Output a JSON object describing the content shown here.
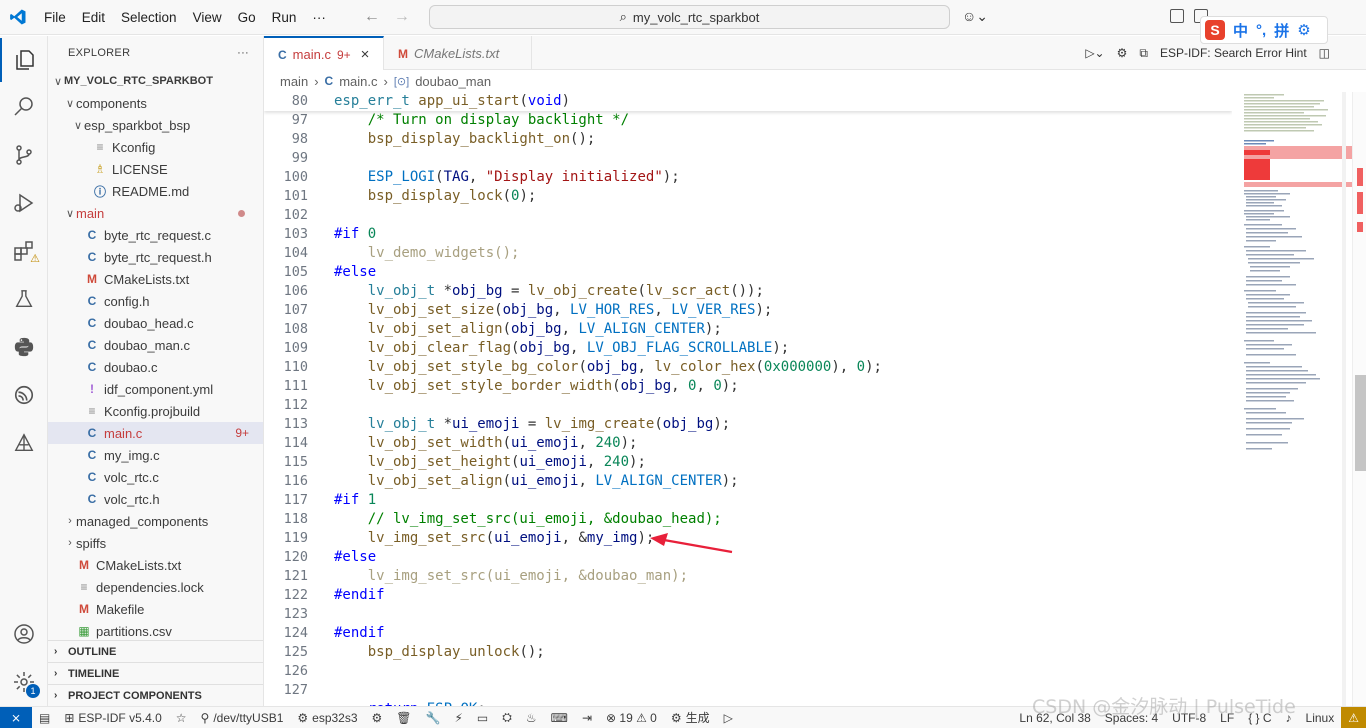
{
  "titlebar": {
    "menu": [
      "File",
      "Edit",
      "Selection",
      "View",
      "Go",
      "Run",
      "···"
    ],
    "search": "my_volc_rtc_sparkbot"
  },
  "ime": {
    "badge": "S",
    "items": [
      "中",
      "°,",
      "拼",
      "⚙"
    ]
  },
  "explorer": {
    "header": "EXPLORER",
    "more": "···",
    "root": "MY_VOLC_RTC_SPARKBOT",
    "items": [
      {
        "label": "components",
        "chev": "∨",
        "icon": "",
        "indent": 0
      },
      {
        "label": "esp_sparkbot_bsp",
        "chev": "∨",
        "icon": "",
        "indent": 1
      },
      {
        "label": "Kconfig",
        "chev": "",
        "icon": "≡",
        "indent": 2
      },
      {
        "label": "LICENSE",
        "chev": "",
        "icon": "♗",
        "indent": 2
      },
      {
        "label": "README.md",
        "chev": "",
        "icon": "ⓘ",
        "indent": 2
      },
      {
        "label": "main",
        "chev": "∨",
        "icon": "",
        "indent": 0
      },
      {
        "label": "byte_rtc_request.c",
        "chev": "",
        "icon": "C",
        "indent": 1
      },
      {
        "label": "byte_rtc_request.h",
        "chev": "",
        "icon": "C",
        "indent": 1
      },
      {
        "label": "CMakeLists.txt",
        "chev": "",
        "icon": "M",
        "indent": 1
      },
      {
        "label": "config.h",
        "chev": "",
        "icon": "C",
        "indent": 1
      },
      {
        "label": "doubao_head.c",
        "chev": "",
        "icon": "C",
        "indent": 1
      },
      {
        "label": "doubao_man.c",
        "chev": "",
        "icon": "C",
        "indent": 1
      },
      {
        "label": "doubao.c",
        "chev": "",
        "icon": "C",
        "indent": 1
      },
      {
        "label": "idf_component.yml",
        "chev": "",
        "icon": "!",
        "indent": 1
      },
      {
        "label": "Kconfig.projbuild",
        "chev": "",
        "icon": "≡",
        "indent": 1
      },
      {
        "label": "main.c",
        "chev": "",
        "icon": "C",
        "indent": 1,
        "modified": "9+"
      },
      {
        "label": "my_img.c",
        "chev": "",
        "icon": "C",
        "indent": 1
      },
      {
        "label": "volc_rtc.c",
        "chev": "",
        "icon": "C",
        "indent": 1
      },
      {
        "label": "volc_rtc.h",
        "chev": "",
        "icon": "C",
        "indent": 1
      },
      {
        "label": "managed_components",
        "chev": "›",
        "icon": "",
        "indent": 0
      },
      {
        "label": "spiffs",
        "chev": "›",
        "icon": "",
        "indent": 0
      },
      {
        "label": "CMakeLists.txt",
        "chev": "",
        "icon": "M",
        "indent": 0
      },
      {
        "label": "dependencies.lock",
        "chev": "",
        "icon": "≡",
        "indent": 0
      },
      {
        "label": "Makefile",
        "chev": "",
        "icon": "M",
        "indent": 0
      },
      {
        "label": "partitions.csv",
        "chev": "",
        "icon": "▦",
        "indent": 0
      }
    ],
    "sections": [
      "OUTLINE",
      "TIMELINE",
      "PROJECT COMPONENTS"
    ]
  },
  "tabs": [
    {
      "label": "main.c",
      "modified": "9+",
      "close": "×"
    },
    {
      "label": "CMakeLists.txt"
    }
  ],
  "tab_actions": {
    "hint": "ESP-IDF: Search Error Hint"
  },
  "breadcrumb": [
    "main",
    "main.c",
    "doubao_man"
  ],
  "code": [
    {
      "ln": "80",
      "html": "<span class=\"tk-type\">esp_err_t</span> <span class=\"tk-fn\">app_ui_start</span>(<span class=\"tk-kw\">void</span>)"
    },
    {
      "ln": "97",
      "html": "    <span class=\"tk-cm\">/* Turn on display backlight */</span>"
    },
    {
      "ln": "98",
      "html": "    <span class=\"tk-fn\">bsp_display_backlight_on</span>();"
    },
    {
      "ln": "99",
      "html": ""
    },
    {
      "ln": "100",
      "html": "    <span class=\"tk-mac\">ESP_LOGI</span>(<span class=\"tk-var\">TAG</span>, <span class=\"tk-str\">\"Display initialized\"</span>);"
    },
    {
      "ln": "101",
      "html": "    <span class=\"tk-fn\">bsp_display_lock</span>(<span class=\"tk-num\">0</span>);"
    },
    {
      "ln": "102",
      "html": ""
    },
    {
      "ln": "103",
      "html": "<span class=\"tk-pp\">#if</span> <span class=\"tk-num\">0</span>"
    },
    {
      "ln": "104",
      "html": "    <span class=\"tk-dimfn\">lv_demo_widgets();</span>"
    },
    {
      "ln": "105",
      "html": "<span class=\"tk-pp\">#else</span>"
    },
    {
      "ln": "106",
      "html": "    <span class=\"tk-type\">lv_obj_t</span> *<span class=\"tk-var\">obj_bg</span> = <span class=\"tk-fn\">lv_obj_create</span>(<span class=\"tk-fn\">lv_scr_act</span>());"
    },
    {
      "ln": "107",
      "html": "    <span class=\"tk-fn\">lv_obj_set_size</span>(<span class=\"tk-var\">obj_bg</span>, <span class=\"tk-mac\">LV_HOR_RES</span>, <span class=\"tk-mac\">LV_VER_RES</span>);"
    },
    {
      "ln": "108",
      "html": "    <span class=\"tk-fn\">lv_obj_set_align</span>(<span class=\"tk-var\">obj_bg</span>, <span class=\"tk-mac\">LV_ALIGN_CENTER</span>);"
    },
    {
      "ln": "109",
      "html": "    <span class=\"tk-fn\">lv_obj_clear_flag</span>(<span class=\"tk-var\">obj_bg</span>, <span class=\"tk-mac\">LV_OBJ_FLAG_SCROLLABLE</span>);"
    },
    {
      "ln": "110",
      "html": "    <span class=\"tk-fn\">lv_obj_set_style_bg_color</span>(<span class=\"tk-var\">obj_bg</span>, <span class=\"tk-fn\">lv_color_hex</span>(<span class=\"tk-num\">0x000000</span>), <span class=\"tk-num\">0</span>);"
    },
    {
      "ln": "111",
      "html": "    <span class=\"tk-fn\">lv_obj_set_style_border_width</span>(<span class=\"tk-var\">obj_bg</span>, <span class=\"tk-num\">0</span>, <span class=\"tk-num\">0</span>);"
    },
    {
      "ln": "112",
      "html": ""
    },
    {
      "ln": "113",
      "html": "    <span class=\"tk-type\">lv_obj_t</span> *<span class=\"tk-var\">ui_emoji</span> = <span class=\"tk-fn\">lv_img_create</span>(<span class=\"tk-var\">obj_bg</span>);"
    },
    {
      "ln": "114",
      "html": "    <span class=\"tk-fn\">lv_obj_set_width</span>(<span class=\"tk-var\">ui_emoji</span>, <span class=\"tk-num\">240</span>);"
    },
    {
      "ln": "115",
      "html": "    <span class=\"tk-fn\">lv_obj_set_height</span>(<span class=\"tk-var\">ui_emoji</span>, <span class=\"tk-num\">240</span>);"
    },
    {
      "ln": "116",
      "html": "    <span class=\"tk-fn\">lv_obj_set_align</span>(<span class=\"tk-var\">ui_emoji</span>, <span class=\"tk-mac\">LV_ALIGN_CENTER</span>);"
    },
    {
      "ln": "117",
      "html": "<span class=\"tk-pp\">#if</span> <span class=\"tk-num\">1</span>"
    },
    {
      "ln": "118",
      "html": "    <span class=\"tk-cm\">// lv_img_set_src(ui_emoji, &amp;doubao_head);</span>"
    },
    {
      "ln": "119",
      "html": "    <span class=\"tk-fn\">lv_img_set_src</span>(<span class=\"tk-var\">ui_emoji</span>, &amp;<span class=\"tk-var\">my_img</span>);"
    },
    {
      "ln": "120",
      "html": "<span class=\"tk-pp\">#else</span>"
    },
    {
      "ln": "121",
      "html": "    <span class=\"tk-dimfn\">lv_img_set_src(ui_emoji, &amp;doubao_man);</span>"
    },
    {
      "ln": "122",
      "html": "<span class=\"tk-pp\">#endif</span>"
    },
    {
      "ln": "123",
      "html": ""
    },
    {
      "ln": "124",
      "html": "<span class=\"tk-pp\">#endif</span>"
    },
    {
      "ln": "125",
      "html": "    <span class=\"tk-fn\">bsp_display_unlock</span>();"
    },
    {
      "ln": "126",
      "html": ""
    },
    {
      "ln": "127",
      "html": ""
    },
    {
      "ln": "",
      "html": "    <span class=\"tk-kw\">return</span> <span class=\"tk-mac\">ESP_OK</span>;"
    }
  ],
  "status": {
    "remote": "⨯",
    "items": [
      "ESP-IDF v5.4.0",
      "/dev/ttyUSB1",
      "esp32s3",
      "⊗ 19 ⚠ 0",
      "生成"
    ],
    "right": [
      "Ln 62, Col 38",
      "Spaces: 4",
      "UTF-8",
      "LF",
      "{ } C",
      "Linux"
    ]
  },
  "watermark": "CSDN @金汐脉动 | PulseTide",
  "colors": {
    "accent": "#005fb8",
    "arrow": "#e8203a"
  }
}
